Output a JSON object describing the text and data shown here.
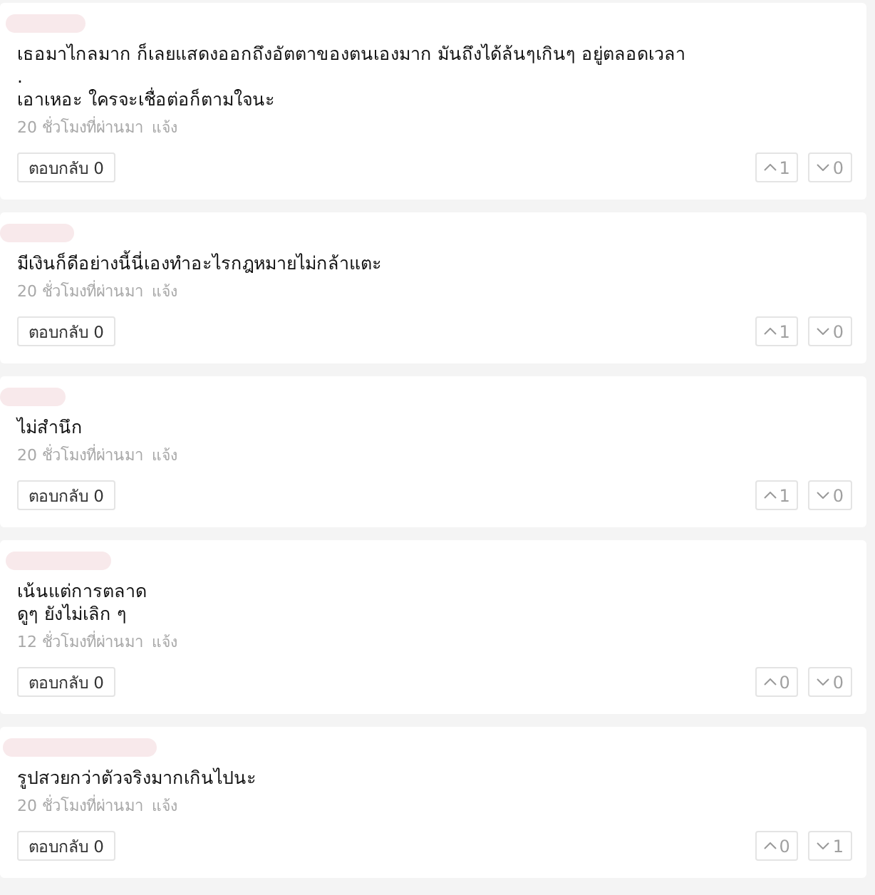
{
  "comments": [
    {
      "lines": [
        "เธอมาไกลมาก ก็เลยแสดงออกถึงอัตตาของตนเองมาก มันถึงได้ล้นๆเกินๆ อยู่ตลอดเวลา",
        ".",
        "เอาเหอะ ใครจะเชื่อต่อก็ตามใจนะ"
      ],
      "time": "20 ชั่วโมงที่ผ่านมา",
      "report": "แจ้ง",
      "reply": "ตอบกลับ 0",
      "upvotes": "1",
      "downvotes": "0"
    },
    {
      "lines": [
        "มีเงินก็ดีอย่างนี้นี่เองทำอะไรกฎหมายไม่กล้าแตะ"
      ],
      "time": "20 ชั่วโมงที่ผ่านมา",
      "report": "แจ้ง",
      "reply": "ตอบกลับ 0",
      "upvotes": "1",
      "downvotes": "0"
    },
    {
      "lines": [
        "ไม่สำนึก"
      ],
      "time": "20 ชั่วโมงที่ผ่านมา",
      "report": "แจ้ง",
      "reply": "ตอบกลับ 0",
      "upvotes": "1",
      "downvotes": "0"
    },
    {
      "lines": [
        "เน้นแต่การตลาด",
        "ดูๆ ยังไม่เลิก ๆ"
      ],
      "time": "12 ชั่วโมงที่ผ่านมา",
      "report": "แจ้ง",
      "reply": "ตอบกลับ 0",
      "upvotes": "0",
      "downvotes": "0"
    },
    {
      "lines": [
        "รูปสวยกว่าตัวจริงมากเกินไปนะ"
      ],
      "time": "20 ชั่วโมงที่ผ่านมา",
      "report": "แจ้ง",
      "reply": "ตอบกลับ 0",
      "upvotes": "0",
      "downvotes": "1"
    }
  ]
}
